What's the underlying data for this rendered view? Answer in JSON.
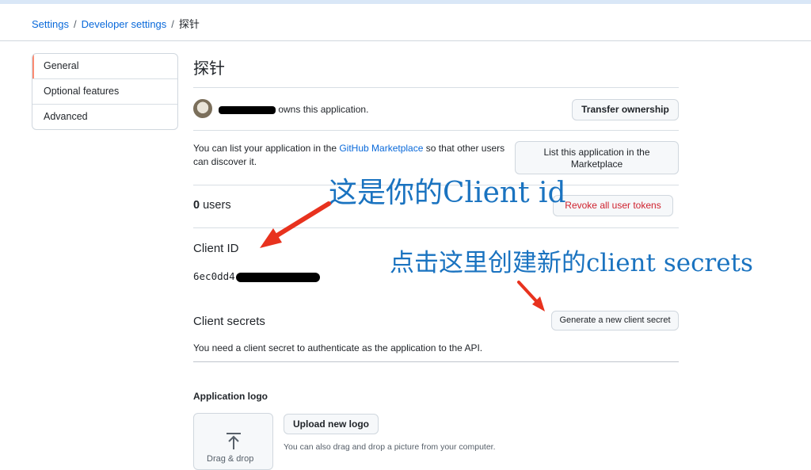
{
  "breadcrumb": {
    "items": [
      "Settings",
      "Developer settings"
    ],
    "current": "探针",
    "separator": "/"
  },
  "sidebar": {
    "items": [
      {
        "label": "General",
        "active": true
      },
      {
        "label": "Optional features",
        "active": false
      },
      {
        "label": "Advanced",
        "active": false
      }
    ]
  },
  "app": {
    "title": "探针",
    "owner_text": "owns this application.",
    "transfer_button": "Transfer ownership",
    "marketplace_text_before": "You can list your application in the ",
    "marketplace_link": "GitHub Marketplace",
    "marketplace_text_after": " so that other users can discover it.",
    "marketplace_button": "List this application in the Marketplace",
    "users_count": "0",
    "users_label": "users",
    "revoke_button": "Revoke all user tokens",
    "client_id_heading": "Client ID",
    "client_id_visible": "6ec0dd4",
    "client_secrets_heading": "Client secrets",
    "generate_secret_button": "Generate a new client secret",
    "client_secrets_desc": "You need a client secret to authenticate as the application to the API.",
    "logo_heading": "Application logo",
    "upload_logo_button": "Upload new logo",
    "drag_drop_hint": "You can also drag and drop a picture from your computer.",
    "drag_drop_label": "Drag & drop"
  },
  "annotations": {
    "client_id_note": "这是你的Client id",
    "client_secret_note": "点击这里创建新的client secrets",
    "color": "#1a73c0",
    "arrow_color": "#e8321e"
  }
}
